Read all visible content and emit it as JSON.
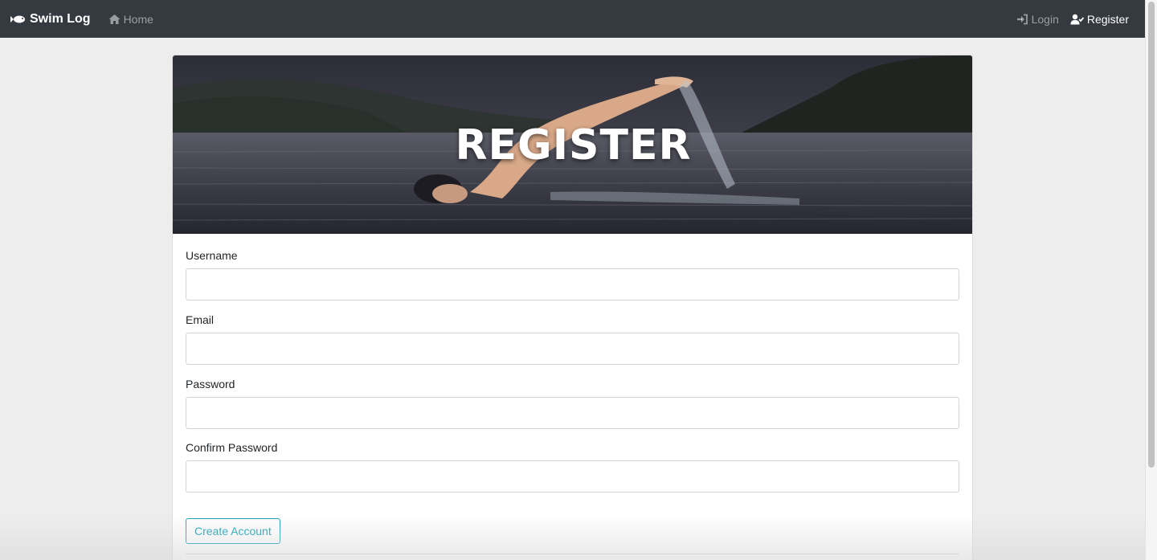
{
  "navbar": {
    "brand": "Swim Log",
    "brand_icon": "fish-icon",
    "home_label": "Home",
    "home_icon": "home-icon",
    "login_label": "Login",
    "login_icon": "sign-in-icon",
    "register_label": "Register",
    "register_icon": "user-check-icon"
  },
  "hero": {
    "title": "REGISTER"
  },
  "form": {
    "fields": [
      {
        "label": "Username",
        "value": "",
        "placeholder": ""
      },
      {
        "label": "Email",
        "value": "",
        "placeholder": ""
      },
      {
        "label": "Password",
        "value": "",
        "placeholder": ""
      },
      {
        "label": "Confirm Password",
        "value": "",
        "placeholder": ""
      }
    ],
    "submit_label": "Create Account"
  },
  "colors": {
    "navbar_bg": "#343a40",
    "page_bg": "#ededed",
    "accent": "#17a2b8"
  }
}
